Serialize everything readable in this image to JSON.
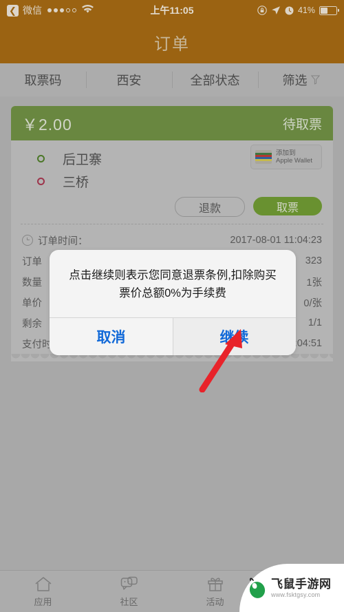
{
  "status_bar": {
    "back_label": "微信",
    "back_icon": "chevron-left-icon",
    "signal_dots_filled": 3,
    "signal_dots_total": 5,
    "wifi_icon": "wifi-icon",
    "time": "上午11:05",
    "rotation_lock_icon": "rotation-lock-icon",
    "location_icon": "location-arrow-icon",
    "alarm_icon": "alarm-clock-icon",
    "battery_percent": "41%",
    "battery_level": 41
  },
  "navbar": {
    "title": "订单"
  },
  "filter_bar": {
    "items": [
      {
        "label": "取票码",
        "icon": ""
      },
      {
        "label": "西安",
        "icon": ""
      },
      {
        "label": "全部状态",
        "icon": ""
      },
      {
        "label": "筛选",
        "icon": "funnel-icon"
      }
    ]
  },
  "ticket": {
    "price": "￥2.00",
    "status": "待取票",
    "origin": "后卫寨",
    "destination": "三桥",
    "wallet_button": {
      "line1": "添加到",
      "line2": "Apple Wallet",
      "icon": "wallet-card-icon"
    },
    "refund_button": "退款",
    "pickup_button": "取票",
    "meta": [
      {
        "icon": "clock-icon",
        "label": "订单时间：",
        "value": "2017-08-01 11:04:23"
      },
      {
        "icon": "",
        "label": "订单",
        "value": "323"
      },
      {
        "icon": "",
        "label": "数量",
        "value": "1张"
      },
      {
        "icon": "",
        "label": "单价",
        "value": "0/张"
      },
      {
        "icon": "",
        "label": "剩余",
        "value": "1/1"
      },
      {
        "icon": "",
        "label": "支付时间：",
        "value": "2017-08-01 11:04:51"
      }
    ]
  },
  "dialog": {
    "message": "点击继续则表示您同意退票条例,扣除购买票价总额0%为手续费",
    "cancel_label": "取消",
    "confirm_label": "继续"
  },
  "annotation": {
    "arrow_icon": "red-arrow-icon",
    "points_to": "继续"
  },
  "tabbar": {
    "items": [
      {
        "label": "应用",
        "icon": "home-icon"
      },
      {
        "label": "社区",
        "icon": "chat-bubbles-icon"
      },
      {
        "label": "活动",
        "icon": "gift-icon"
      },
      {
        "label": "",
        "icon": "profile-icon"
      }
    ]
  },
  "watermark": {
    "name": "飞鼠手游网",
    "url": "www.fsktgsy.com",
    "logo_icon": "mouse-logo-icon"
  },
  "colors": {
    "brand_bar": "#a5660a",
    "ticket_header_green": "#6d8f3e",
    "pickup_green": "#6d9a2c",
    "dialog_blue": "#1169d8",
    "origin_ring": "#4b7d22",
    "dest_ring": "#a8304a",
    "arrow_red": "#e8232a",
    "page_bg": "#b4b4b4"
  }
}
